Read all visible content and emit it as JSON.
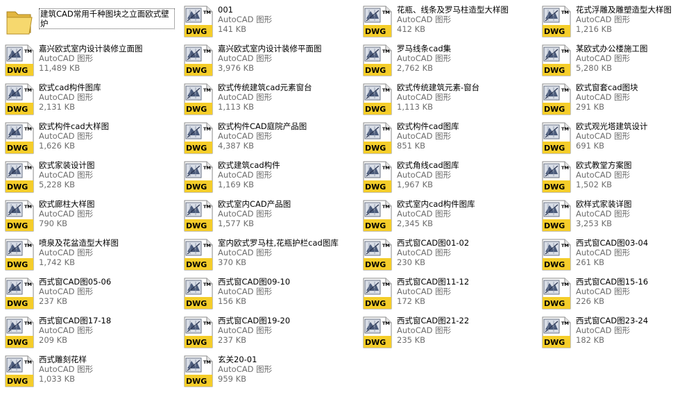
{
  "icons": {
    "dwg": "dwg-file-icon",
    "folder": "folder-icon"
  },
  "items": [
    {
      "kind": "folder",
      "name": "建筑CAD常用千种图块之立面欧式壁炉",
      "type": "",
      "size": ""
    },
    {
      "kind": "dwg",
      "name": "001",
      "type": "AutoCAD 图形",
      "size": "141 KB"
    },
    {
      "kind": "dwg",
      "name": "花瓶、线条及罗马柱造型大样图",
      "type": "AutoCAD 图形",
      "size": "412 KB"
    },
    {
      "kind": "dwg",
      "name": "花式浮雕及雕塑造型大样图",
      "type": "AutoCAD 图形",
      "size": "1,216 KB"
    },
    {
      "kind": "dwg",
      "name": "嘉兴欧式室内设计装修立面图",
      "type": "AutoCAD 图形",
      "size": "11,489 KB"
    },
    {
      "kind": "dwg",
      "name": "嘉兴欧式室内设计装修平面图",
      "type": "AutoCAD 图形",
      "size": "3,976 KB"
    },
    {
      "kind": "dwg",
      "name": "罗马线条cad集",
      "type": "AutoCAD 图形",
      "size": "2,762 KB"
    },
    {
      "kind": "dwg",
      "name": "某欧式办公楼施工图",
      "type": "AutoCAD 图形",
      "size": "5,280 KB"
    },
    {
      "kind": "dwg",
      "name": "欧式cad构件图库",
      "type": "AutoCAD 图形",
      "size": "2,131 KB"
    },
    {
      "kind": "dwg",
      "name": "欧式传统建筑cad元素窗台",
      "type": "AutoCAD 图形",
      "size": "1,113 KB"
    },
    {
      "kind": "dwg",
      "name": "欧式传统建筑元素-窗台",
      "type": "AutoCAD 图形",
      "size": "1,113 KB"
    },
    {
      "kind": "dwg",
      "name": "欧式窗套cad图块",
      "type": "AutoCAD 图形",
      "size": "291 KB"
    },
    {
      "kind": "dwg",
      "name": "欧式构件cad大样图",
      "type": "AutoCAD 图形",
      "size": "1,626 KB"
    },
    {
      "kind": "dwg",
      "name": "欧式构件CAD庭院产品图",
      "type": "AutoCAD 图形",
      "size": "4,387 KB"
    },
    {
      "kind": "dwg",
      "name": "欧式构件cad图库",
      "type": "AutoCAD 图形",
      "size": "851 KB"
    },
    {
      "kind": "dwg",
      "name": "欧式观光塔建筑设计",
      "type": "AutoCAD 图形",
      "size": "691 KB"
    },
    {
      "kind": "dwg",
      "name": "欧式家装设计图",
      "type": "AutoCAD 图形",
      "size": "5,228 KB"
    },
    {
      "kind": "dwg",
      "name": "欧式建筑cad构件",
      "type": "AutoCAD 图形",
      "size": "1,169 KB"
    },
    {
      "kind": "dwg",
      "name": "欧式角线cad图库",
      "type": "AutoCAD 图形",
      "size": "1,967 KB"
    },
    {
      "kind": "dwg",
      "name": "欧式教堂方案图",
      "type": "AutoCAD 图形",
      "size": "1,502 KB"
    },
    {
      "kind": "dwg",
      "name": "欧式廊柱大样图",
      "type": "AutoCAD 图形",
      "size": "790 KB"
    },
    {
      "kind": "dwg",
      "name": "欧式室内CAD产品图",
      "type": "AutoCAD 图形",
      "size": "1,577 KB"
    },
    {
      "kind": "dwg",
      "name": "欧式室内cad构件图库",
      "type": "AutoCAD 图形",
      "size": "2,345 KB"
    },
    {
      "kind": "dwg",
      "name": "欧样式家装详图",
      "type": "AutoCAD 图形",
      "size": "3,253 KB"
    },
    {
      "kind": "dwg",
      "name": "喷泉及花盆造型大样图",
      "type": "AutoCAD 图形",
      "size": "1,742 KB"
    },
    {
      "kind": "dwg",
      "name": "室内欧式罗马柱,花瓶护栏cad图库",
      "type": "AutoCAD 图形",
      "size": "370 KB"
    },
    {
      "kind": "dwg",
      "name": "西式窗CAD图01-02",
      "type": "AutoCAD 图形",
      "size": "230 KB"
    },
    {
      "kind": "dwg",
      "name": "西式窗CAD图03-04",
      "type": "AutoCAD 图形",
      "size": "261 KB"
    },
    {
      "kind": "dwg",
      "name": "西式窗CAD图05-06",
      "type": "AutoCAD 图形",
      "size": "237 KB"
    },
    {
      "kind": "dwg",
      "name": "西式窗CAD图09-10",
      "type": "AutoCAD 图形",
      "size": "156 KB"
    },
    {
      "kind": "dwg",
      "name": "西式窗CAD图11-12",
      "type": "AutoCAD 图形",
      "size": "172 KB"
    },
    {
      "kind": "dwg",
      "name": "西式窗CAD图15-16",
      "type": "AutoCAD 图形",
      "size": "226 KB"
    },
    {
      "kind": "dwg",
      "name": "西式窗CAD图17-18",
      "type": "AutoCAD 图形",
      "size": "209 KB"
    },
    {
      "kind": "dwg",
      "name": "西式窗CAD图19-20",
      "type": "AutoCAD 图形",
      "size": "237 KB"
    },
    {
      "kind": "dwg",
      "name": "西式窗CAD图21-22",
      "type": "AutoCAD 图形",
      "size": "235 KB"
    },
    {
      "kind": "dwg",
      "name": "西式窗CAD图23-24",
      "type": "AutoCAD 图形",
      "size": "182 KB"
    },
    {
      "kind": "dwg",
      "name": "西式雕刻花样",
      "type": "AutoCAD 图形",
      "size": "1,033 KB"
    },
    {
      "kind": "dwg",
      "name": "玄关20-01",
      "type": "AutoCAD 图形",
      "size": "959 KB"
    }
  ]
}
